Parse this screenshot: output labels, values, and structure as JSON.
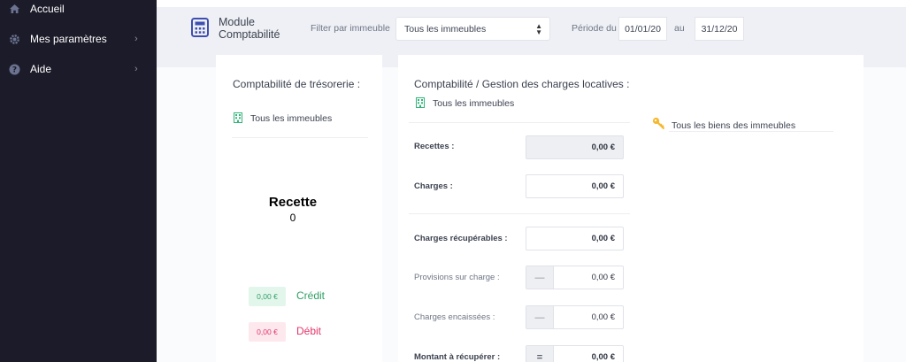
{
  "sidebar": {
    "items": [
      {
        "label": "Accueil",
        "icon": "home-icon"
      },
      {
        "label": "Mes paramètres",
        "icon": "gear-icon",
        "chevron": "›"
      },
      {
        "label": "Aide",
        "icon": "help-icon",
        "chevron": "›"
      }
    ]
  },
  "header": {
    "module_title": "Module Comptabilité",
    "filter_label": "Filter par immeuble",
    "filter_value": "Tous les immeubles",
    "period_label": "Période du :",
    "date_from": "01/01/20",
    "au_label": "au",
    "date_to": "31/12/20"
  },
  "left_card": {
    "title": "Comptabilité de trésorerie :",
    "scope": "Tous les immeubles",
    "recette_title": "Recette",
    "recette_value": "0",
    "credit_amount": "0,00 €",
    "credit_label": "Crédit",
    "debit_amount": "0,00 €",
    "debit_label": "Débit"
  },
  "right_card": {
    "title": "Comptabilité / Gestion des charges locatives :",
    "scope": "Tous les immeubles",
    "rows": [
      {
        "label": "Recettes :",
        "value": "0,00 €"
      },
      {
        "label": "Charges :",
        "value": "0,00 €"
      },
      {
        "label": "Charges récupérables :",
        "value": "0,00 €"
      },
      {
        "label": "Provisions sur charge :",
        "value": "0,00 €",
        "prefix": "—"
      },
      {
        "label": "Charges encaissées :",
        "value": "0,00 €",
        "prefix": "—"
      },
      {
        "label": "Montant à récupérer :",
        "value": "0,00 €",
        "prefix": "="
      }
    ],
    "properties_label": "Tous les biens des immeubles"
  },
  "colors": {
    "sidebar_bg": "#1c1b29",
    "accent_blue": "#3f4fb0",
    "building_green": "#34b47a",
    "credit_green": "#2e9f64",
    "debit_pink": "#e3346a",
    "key_yellow": "#f5b82e"
  }
}
